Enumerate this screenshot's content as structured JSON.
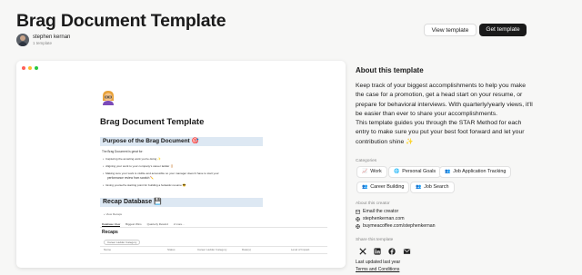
{
  "header": {
    "title": "Brag Document Template",
    "author_name": "stephen kernan",
    "author_sub": "1 template",
    "view_button": "View template",
    "get_button": "Get template"
  },
  "preview": {
    "page_title": "Brag Document Template",
    "section1_heading": "Purpose of the Brag Document 🎯",
    "intro": "The Brag Document is great for:",
    "bullets": [
      "Capturing the amazing work you're doing ✨",
      "Aligning your work to your company's career ladder 🪜",
      "Making sure your work is visible and accessible so your manager doesn't have to start your",
      "performance review from scratch ✏️",
      "Giving yourself a starting point for building a fantastic resume 😎"
    ],
    "section2_heading": "Recap Database 💾",
    "view_recaps": "+ View Recaps",
    "tabs": [
      "Database View",
      "Biggest Wins",
      "Quarterly Rewind",
      "2 more..."
    ],
    "recaps_heading": "Recaps",
    "filter": "Career Ladder Category",
    "columns": [
      "Name",
      "Status",
      "Career Ladder Category",
      "Date(s)",
      "Level of Impact"
    ]
  },
  "side": {
    "about_title": "About this template",
    "description": "Keep track of your biggest accomplishments to help you make the case for a promotion, get a head start on your resume, or prepare for behavioral interviews. With quarterly/yearly views, it'll be easier than ever to share your accomplishments.\nThis template guides you through the STAR Method for each entry to make sure you put your best foot forward and let your contribution shine ✨",
    "categories_label": "Categories",
    "categories": [
      "Work",
      "Personal Goals",
      "Job Application Tracking",
      "Career Building",
      "Job Search"
    ],
    "creator_label": "About this creator",
    "creator_links": [
      "Email the creator",
      "stephenkernan.com",
      "buymeacoffee.com/stephenkernan"
    ],
    "share_label": "Share this template",
    "share_icons": [
      "x-icon",
      "linkedin-icon",
      "facebook-icon",
      "email-icon"
    ],
    "last_updated": "Last updated last year",
    "terms": "Terms and Conditions"
  }
}
